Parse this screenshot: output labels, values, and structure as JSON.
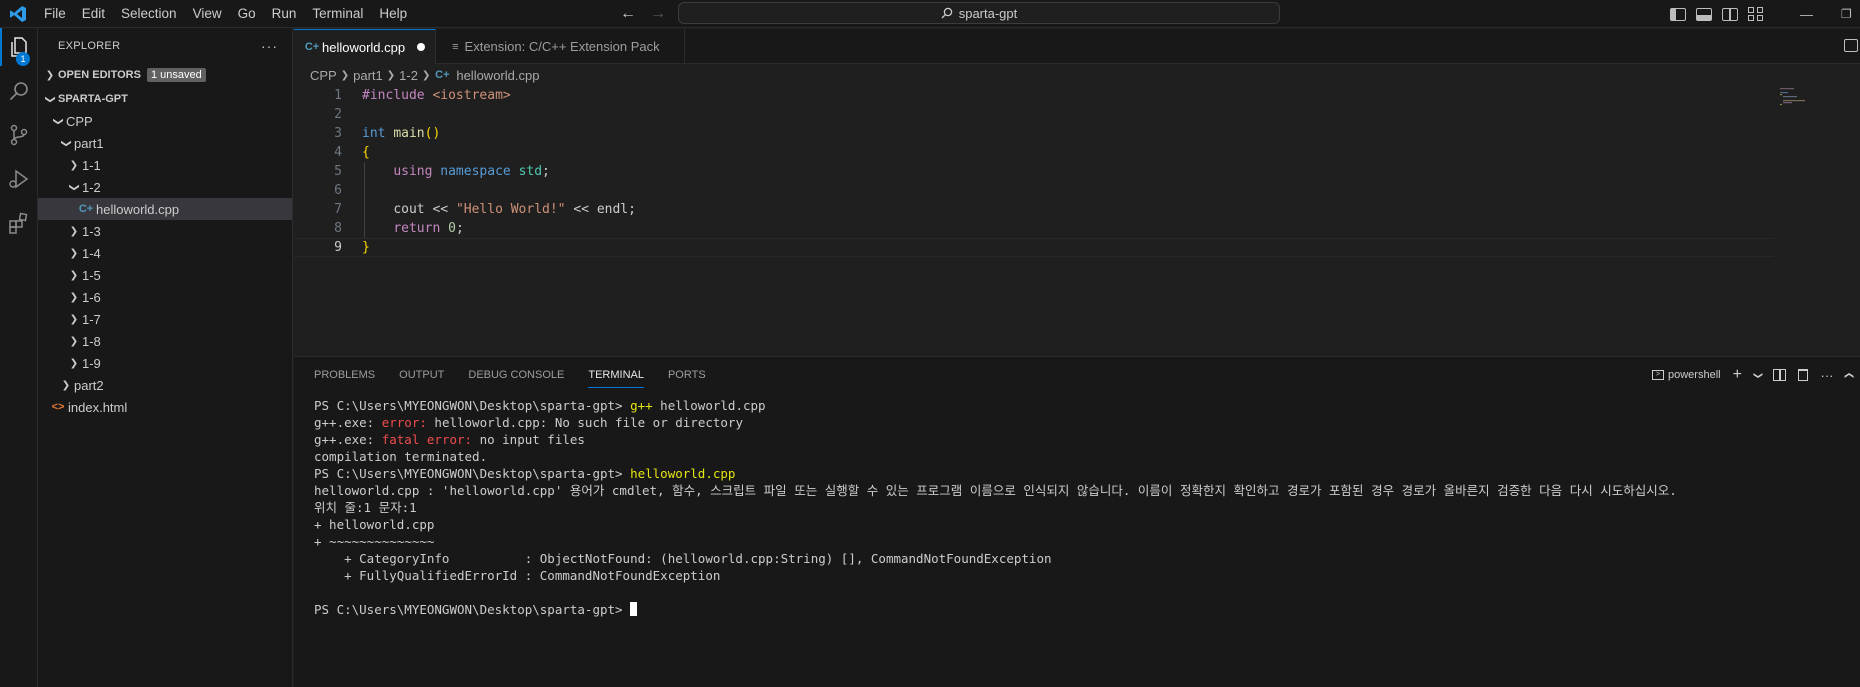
{
  "titlebar": {
    "menu": [
      "File",
      "Edit",
      "Selection",
      "View",
      "Go",
      "Run",
      "Terminal",
      "Help"
    ],
    "search_text": "sparta-gpt"
  },
  "activitybar": {
    "explorer_badge": "1"
  },
  "sidebar": {
    "title": "EXPLORER",
    "more": "···",
    "open_editors": "OPEN EDITORS",
    "unsaved_badge": "1 unsaved",
    "root": "SPARTA-GPT",
    "tree": {
      "cpp": "CPP",
      "part1": "part1",
      "f_1_1": "1-1",
      "f_1_2": "1-2",
      "helloworld": "helloworld.cpp",
      "f_1_3": "1-3",
      "f_1_4": "1-4",
      "f_1_5": "1-5",
      "f_1_6": "1-6",
      "f_1_7": "1-7",
      "f_1_8": "1-8",
      "f_1_9": "1-9",
      "part2": "part2",
      "index": "index.html"
    }
  },
  "tabs": {
    "active": "helloworld.cpp",
    "other": "Extension: C/C++ Extension Pack"
  },
  "breadcrumb": [
    "CPP",
    "part1",
    "1-2",
    "helloworld.cpp"
  ],
  "editor": {
    "line_numbers": [
      "1",
      "2",
      "3",
      "4",
      "5",
      "6",
      "7",
      "8",
      "9"
    ],
    "l1_directive": "#include",
    "l1_header": "<iostream>",
    "l3_type": "int",
    "l3_fn": "main",
    "l3_parens": "()",
    "l4_brace": "{",
    "l5_using": "using",
    "l5_namespace": "namespace",
    "l5_std": "std",
    "l5_semi": ";",
    "l7_cout": "cout << ",
    "l7_string": "\"Hello World!\"",
    "l7_rest": " << endl;",
    "l8_return": "return",
    "l8_zero": "0",
    "l8_semi": ";",
    "l9_brace": "}"
  },
  "panel": {
    "tabs": [
      "PROBLEMS",
      "OUTPUT",
      "DEBUG CONSOLE",
      "TERMINAL",
      "PORTS"
    ],
    "shell": "powershell",
    "terminal": {
      "l1_prompt": "PS C:\\Users\\MYEONGWON\\Desktop\\sparta-gpt> ",
      "l1_cmd": "g++",
      "l1_rest": " helloworld.cpp",
      "l2_a": "g++.exe: ",
      "l2_err": "error: ",
      "l2_b": "helloworld.cpp: No such file or directory",
      "l3_a": "g++.exe: ",
      "l3_err": "fatal error: ",
      "l3_b": "no input files",
      "l4": "compilation terminated.",
      "l5_prompt": "PS C:\\Users\\MYEONGWON\\Desktop\\sparta-gpt> ",
      "l5_cmd": "helloworld.cpp",
      "l6": "helloworld.cpp : 'helloworld.cpp' 용어가 cmdlet, 함수, 스크립트 파일 또는 실행할 수 있는 프로그램 이름으로 인식되지 않습니다. 이름이 정확한지 확인하고 경로가 포함된 경우 경로가 올바른지 검증한 다음 다시 시도하십시오.",
      "l7": "위치 줄:1 문자:1",
      "l8": "+ helloworld.cpp",
      "l9": "+ ~~~~~~~~~~~~~~",
      "l10": "    + CategoryInfo          : ObjectNotFound: (helloworld.cpp:String) [], CommandNotFoundException",
      "l11": "    + FullyQualifiedErrorId : CommandNotFoundException",
      "l12_prompt": "PS C:\\Users\\MYEONGWON\\Desktop\\sparta-gpt> "
    }
  }
}
